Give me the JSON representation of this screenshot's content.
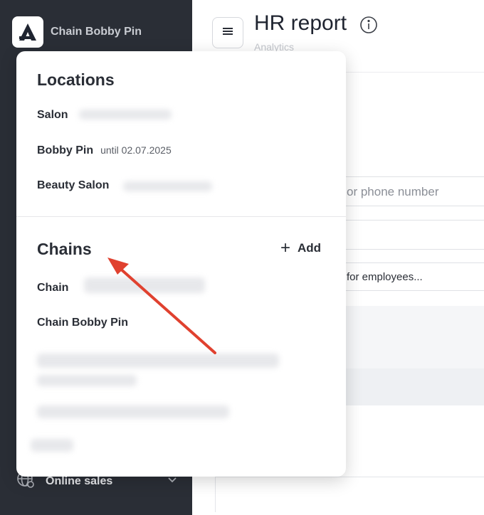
{
  "sidebar": {
    "brand_name": "Chain Bobby Pin",
    "online_sales_label": "Online sales"
  },
  "header": {
    "title": "HR report",
    "subtitle": "Analytics"
  },
  "main": {
    "search_placeholder": "or phone number",
    "employees_placeholder": "for employees..."
  },
  "popup": {
    "locations_title": "Locations",
    "locations": [
      {
        "name": "Salon",
        "note": ""
      },
      {
        "name": "Bobby Pin",
        "note": "until 02.07.2025"
      },
      {
        "name": "Beauty Salon",
        "note": ""
      }
    ],
    "chains_title": "Chains",
    "add_label": "Add",
    "chains": [
      {
        "name": "Chain"
      },
      {
        "name": "Chain Bobby Pin"
      }
    ]
  },
  "colors": {
    "sidebar_bg": "#2a2e36",
    "arrow": "#e0412f"
  },
  "icons": [
    "app-logo-icon",
    "menu-icon",
    "info-icon",
    "plus-icon",
    "globe-icon",
    "chevron-down-icon"
  ]
}
